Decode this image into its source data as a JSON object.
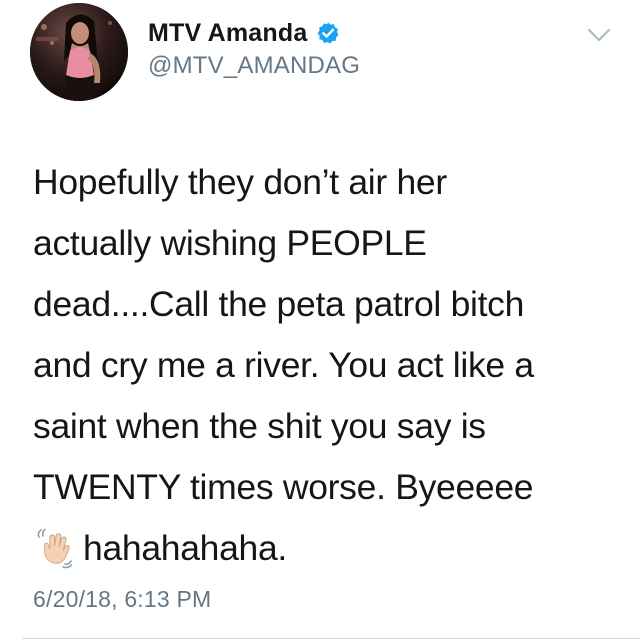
{
  "tweet": {
    "author": {
      "display_name": "MTV Amanda",
      "handle": "@MTV_AMANDAG",
      "verified": true,
      "avatar_icon": "profile-photo"
    },
    "menu_icon": "chevron-down-icon",
    "text_lines": [
      "Hopefully they don’t air her",
      "actually wishing PEOPLE",
      "dead....Call the peta patrol bitch",
      "and cry me a river. You act like a",
      "saint when the shit you say is",
      "TWENTY times worse. Byeeeee",
      "hahahahaha."
    ],
    "emoji": "waving-hand-light-skin-tone",
    "timestamp": "6/20/18, 6:13 PM"
  },
  "colors": {
    "text_primary": "#14171a",
    "text_secondary": "#657786",
    "verified_blue": "#1da1f2",
    "divider": "#d8dde2"
  }
}
